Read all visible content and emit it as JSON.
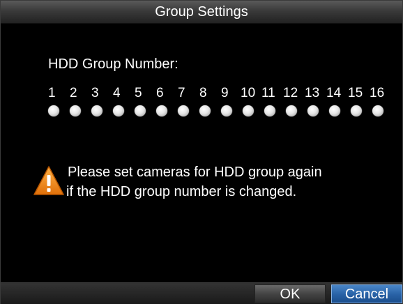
{
  "dialog": {
    "title": "Group Settings",
    "group_label": "HDD Group Number:",
    "groups": [
      "1",
      "2",
      "3",
      "4",
      "5",
      "6",
      "7",
      "8",
      "9",
      "10",
      "11",
      "12",
      "13",
      "14",
      "15",
      "16"
    ],
    "warning": {
      "icon": "warning-triangle-icon",
      "line1": "Please set cameras for HDD group again",
      "line2": "if the HDD group number is changed."
    },
    "buttons": {
      "ok_label": "OK",
      "cancel_label": "Cancel"
    },
    "colors": {
      "accent": "#2a64a8",
      "warning": "#f08a1c"
    }
  }
}
